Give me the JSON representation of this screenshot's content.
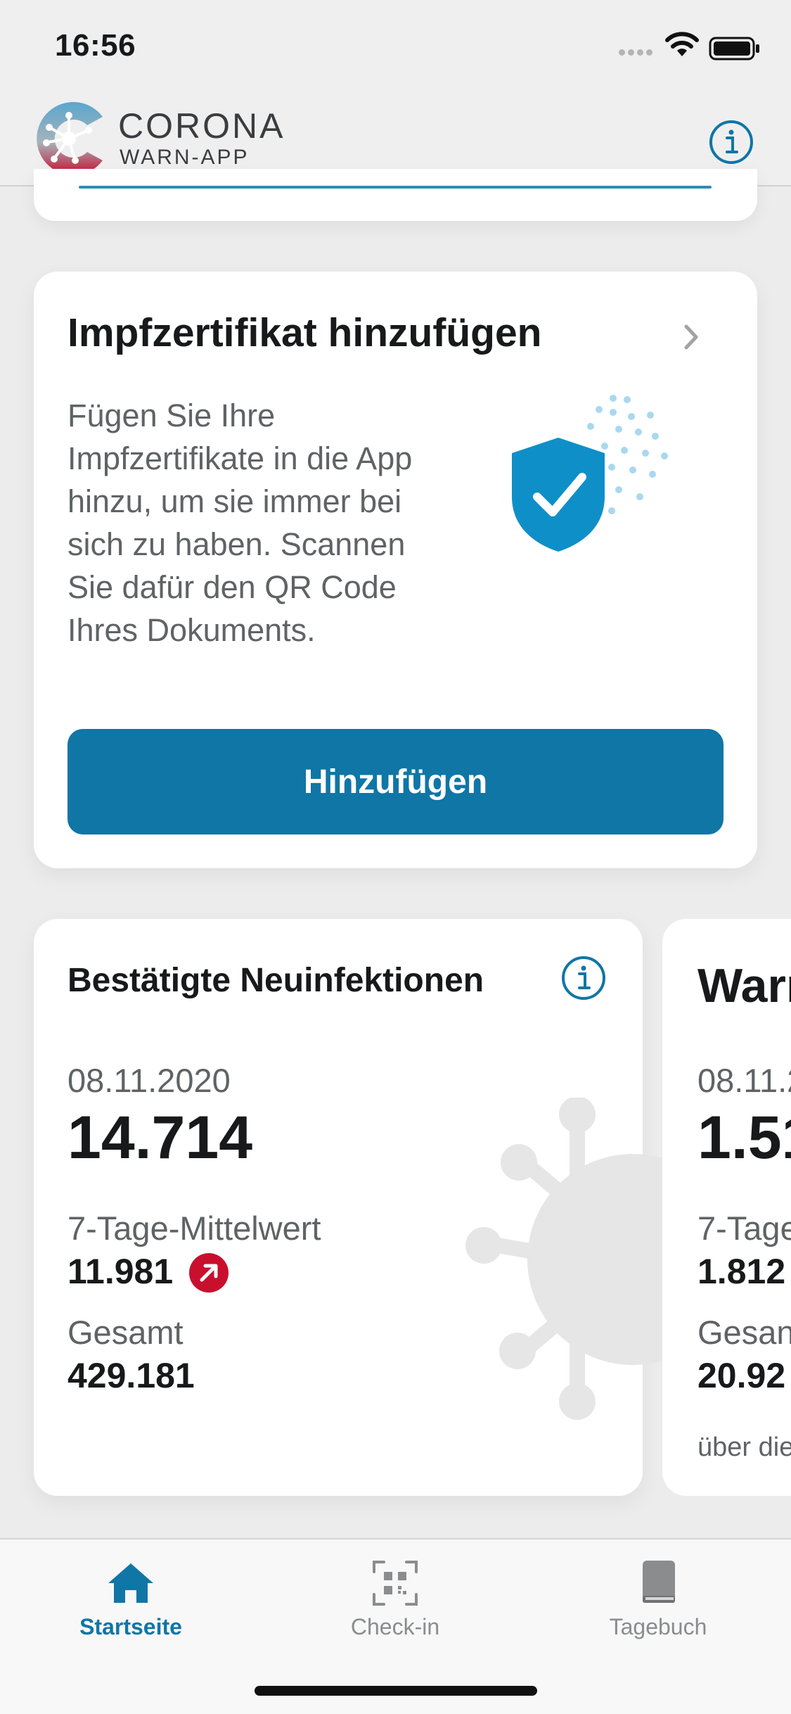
{
  "status_bar": {
    "time": "16:56"
  },
  "header": {
    "logo_title": "CORONA",
    "logo_subtitle": "WARN-APP",
    "info_icon": "info-circle-icon"
  },
  "vaccination_card": {
    "title": "Impfzertifikat hinzufügen",
    "body": "Fügen Sie Ihre Impfzertifikate in die App hinzu, um sie immer bei sich zu haben. Scannen Sie dafür den QR Code Ihres Dokuments.",
    "button_label": "Hinzufügen",
    "illustration": "shield-check-icon"
  },
  "stats_card": {
    "title": "Bestätigte Neuinfektionen",
    "date": "08.11.2020",
    "value": "14.714",
    "label_avg": "7-Tage-Mittelwert",
    "value_avg": "11.981",
    "trend": "up",
    "label_total": "Gesamt",
    "value_total": "429.181"
  },
  "stats_card_2": {
    "title": "Warn",
    "date": "08.11.2",
    "value": "1.51",
    "label_avg": "7-Tage",
    "value_avg": "1.812",
    "label_total": "Gesan",
    "value_total": "20.92",
    "footer": "über die"
  },
  "tab_bar": {
    "tabs": [
      {
        "label": "Startseite",
        "icon": "home-icon",
        "active": true
      },
      {
        "label": "Check-in",
        "icon": "qr-code-icon",
        "active": false
      },
      {
        "label": "Tagebuch",
        "icon": "book-icon",
        "active": false
      }
    ]
  },
  "colors": {
    "accent": "#0f76a6",
    "trend_red": "#c8102e",
    "background": "#ececec",
    "card": "#ffffff"
  }
}
